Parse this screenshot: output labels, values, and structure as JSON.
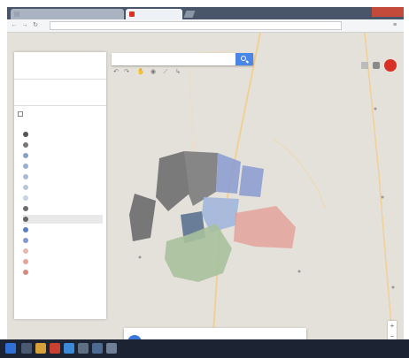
{
  "browser": {
    "tabs": [
      {
        "label": "",
        "state": "inactive"
      },
      {
        "label": "",
        "state": "active"
      }
    ],
    "address": "",
    "favicon_color": "#d93025"
  },
  "sidebar": {
    "title": "",
    "subtitle": "",
    "section_title": "",
    "layer": {
      "name": "",
      "style_link": "",
      "checked": true
    },
    "features": [
      {
        "label": "",
        "color": "#555555"
      },
      {
        "label": "",
        "color": "#777777"
      },
      {
        "label": "",
        "color": "#8aa0c8"
      },
      {
        "label": "",
        "color": "#9ab0d0"
      },
      {
        "label": "",
        "color": "#a9bad4"
      },
      {
        "label": "",
        "color": "#b8c6dc"
      },
      {
        "label": "",
        "color": "#c7d2e4"
      },
      {
        "label": "",
        "color": "#6d6d6d"
      },
      {
        "label": "",
        "color": "#666666"
      },
      {
        "label": "",
        "color": "#5b7fc4"
      },
      {
        "label": "",
        "color": "#7f9ad4"
      },
      {
        "label": "",
        "color": "#e6b8b0"
      },
      {
        "label": "",
        "color": "#e4a59a"
      },
      {
        "label": "",
        "color": "#d98a80"
      }
    ],
    "selected_feature_index": 8,
    "footer": ""
  },
  "search": {
    "placeholder": ""
  },
  "map": {
    "background": "#e4e1da",
    "road_color": "#f3d19c",
    "polygon_colors": [
      "#6f6f6f",
      "#7c7c7c",
      "#8a9ad0",
      "#a2b7dc",
      "#5b7190",
      "#a7c19b",
      "#e39b93",
      "#6b6b6b"
    ]
  },
  "notification": {
    "text": "",
    "subtext": "",
    "action1": "",
    "action2": ""
  },
  "taskbar": {
    "tray": "",
    "time": "",
    "date": ""
  }
}
